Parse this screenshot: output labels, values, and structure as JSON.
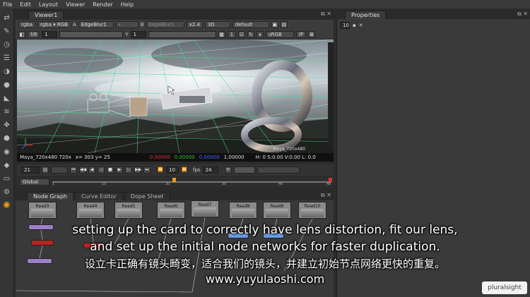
{
  "menubar": {
    "items": [
      "File",
      "Edit",
      "Layout",
      "Viewer",
      "Render",
      "Help"
    ]
  },
  "viewer": {
    "tab_label": "Viewer1",
    "row1": {
      "channels": "rgba",
      "channels2": "rgba",
      "colorspace": "RGB",
      "input_a_label": "A",
      "input_a": "EdgeBlur1",
      "dash": "-",
      "input_b_label": "B",
      "input_b": "EdgeBlur1",
      "zoom": "x2.4",
      "mode": "3D",
      "lut": "default"
    },
    "row2": {
      "fstop": "f/8",
      "gain": "1",
      "gamma_label": "Y",
      "gamma": "1",
      "proxy": "1",
      "display": "sRGB",
      "ip": "IP"
    },
    "status": {
      "format": "Maya_720x480 720x",
      "coords": "x= 303 y= 25",
      "r": "0.00000",
      "g": "0.00000",
      "b": "0.00000",
      "a": "1.00000",
      "hsl": "H: 0 S:0.00 V:0.00 L: 0.0"
    },
    "overlay_format_label": "Maya_720x480",
    "playback": {
      "frame": "21",
      "step": "10",
      "fps_label": "fps",
      "fps": "24"
    },
    "timeline": {
      "range": "Global",
      "ticks": [
        "1",
        "10",
        "20",
        "30",
        "40",
        "48"
      ]
    }
  },
  "properties": {
    "tab_label": "Properties",
    "max_panels": "10"
  },
  "node_graph": {
    "tabs": [
      "Node Graph",
      "Curve Editor",
      "Dope Sheet"
    ],
    "nodes": [
      "Read3",
      "Read4",
      "Read5",
      "Read6",
      "Read7",
      "Read8",
      "Read9",
      "Read10"
    ]
  },
  "subtitles": {
    "line1": "setting up the card to correctly have lens distortion, fit our lens,",
    "line2": "and set up the initial node networks for faster duplication.",
    "line3": "设立卡正确有镜头畸变，适合我们的镜头，并建立初始节点网络更快的重复。",
    "line4": "www.yuyulaoshi.com"
  },
  "watermark": "pluralsight",
  "colors": {
    "accent_orange": "#e89c1a",
    "grid_green": "#3fe08a",
    "red_readout": "#e03030"
  }
}
